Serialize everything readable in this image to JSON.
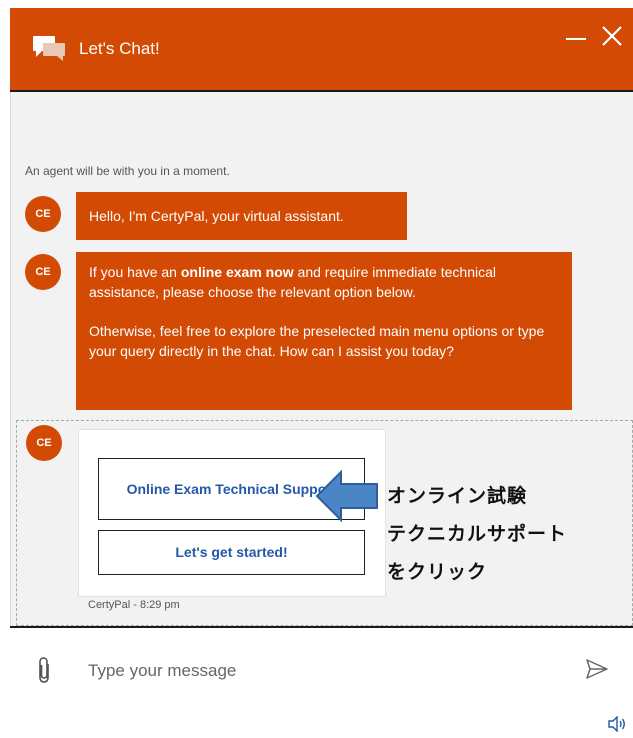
{
  "header": {
    "title": "Let's Chat!",
    "bg_color": "#d24a03",
    "icons": {
      "chat": "chat-bubbles-icon",
      "minimize": "minimize-icon",
      "close": "close-icon"
    }
  },
  "messages": {
    "system_note": "An agent will be with you in a moment.",
    "avatar_initials": "CE",
    "bot_messages": [
      {
        "text": "Hello, I'm CertyPal, your virtual assistant."
      },
      {
        "text_before_bold": "If you have an ",
        "bold": "online exam now",
        "text_after_bold": " and require immediate technical assistance, please choose the relevant option below.",
        "paragraph2": "Otherwise, feel free to explore the preselected main menu options or type your query directly in the chat. How can I assist you today?"
      }
    ],
    "options": {
      "buttons": [
        {
          "label": "Online Exam Technical Support"
        },
        {
          "label": "Let's get started!"
        }
      ],
      "timestamp": "CertyPal - 8:29 pm"
    }
  },
  "annotation": {
    "lines": [
      "オンライン試験",
      "テクニカルサポート",
      "をクリック"
    ],
    "arrow_color": "#4a86c5"
  },
  "composer": {
    "placeholder": "Type your message",
    "icons": {
      "attach": "paperclip-icon",
      "send": "send-icon",
      "sound": "speaker-icon"
    }
  },
  "colors": {
    "brand": "#d24a03",
    "link": "#2459a8"
  }
}
